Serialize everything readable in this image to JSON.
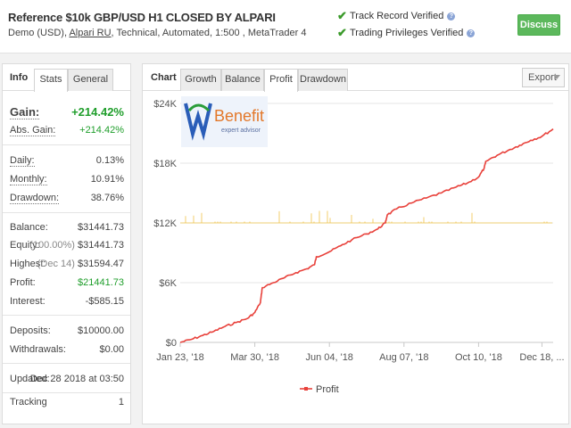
{
  "header": {
    "title": "Reference $10k GBP/USD H1 CLOSED BY ALPARI",
    "sub_prefix": "Demo (USD),",
    "broker": "Alpari RU",
    "sub_suffix": ", Technical, Automated, 1:500 , MetaTrader 4",
    "verify_track": "Track Record Verified",
    "verify_trading": "Trading Privileges Verified",
    "discuss_label": "Discuss",
    "accent_green": "#5cb85c"
  },
  "info": {
    "label": "Info",
    "tabs": [
      "Stats",
      "General"
    ],
    "active_tab": "Stats",
    "gain_label": "Gain:",
    "gain_value": "+214.42%",
    "abs_gain_label": "Abs. Gain:",
    "abs_gain_value": "+214.42%",
    "daily_label": "Daily:",
    "daily_value": "0.13%",
    "monthly_label": "Monthly:",
    "monthly_value": "10.91%",
    "drawdown_label": "Drawdown:",
    "drawdown_value": "38.76%",
    "balance_label": "Balance:",
    "balance_value": "$31441.73",
    "equity_label": "Equity:",
    "equity_note": "(100.00%)",
    "equity_value": "$31441.73",
    "highest_label": "Highest:",
    "highest_note": "(Dec 14)",
    "highest_value": "$31594.47",
    "profit_label": "Profit:",
    "profit_value": "$21441.73",
    "interest_label": "Interest:",
    "interest_value": "-$585.15",
    "deposits_label": "Deposits:",
    "deposits_value": "$10000.00",
    "withdrawals_label": "Withdrawals:",
    "withdrawals_value": "$0.00",
    "updated_label": "Updated:",
    "updated_value": "Dec 28 2018 at 03:50",
    "tracking_label": "Tracking",
    "tracking_value": "1"
  },
  "chart": {
    "label": "Chart",
    "tabs": [
      "Growth",
      "Balance",
      "Profit",
      "Drawdown"
    ],
    "active_tab": "Profit",
    "export_label": "Export",
    "logo_text": "Benefit",
    "logo_sub": "expert advisor"
  },
  "chart_data": {
    "type": "line",
    "title": "",
    "xlabel": "",
    "ylabel": "",
    "ylim": [
      0,
      24000
    ],
    "y_ticks": [
      {
        "value": 0,
        "label": "$0"
      },
      {
        "value": 6000,
        "label": "$6K"
      },
      {
        "value": 12000,
        "label": "$12K"
      },
      {
        "value": 18000,
        "label": "$18K"
      },
      {
        "value": 24000,
        "label": "$24K"
      }
    ],
    "x_ticks": [
      {
        "pos": 0.0,
        "label": "Jan 23, '18"
      },
      {
        "pos": 0.2,
        "label": "Mar 30, '18"
      },
      {
        "pos": 0.4,
        "label": "Jun 04, '18"
      },
      {
        "pos": 0.6,
        "label": "Aug 07, '18"
      },
      {
        "pos": 0.8,
        "label": "Oct 10, '18"
      },
      {
        "pos": 0.97,
        "label": "Dec 18, ..."
      }
    ],
    "grid": true,
    "legend": "bottom-center",
    "series": [
      {
        "name": "Profit",
        "color": "#e8413b",
        "x": [
          0.0,
          0.03,
          0.06,
          0.09,
          0.12,
          0.15,
          0.18,
          0.2,
          0.215,
          0.22,
          0.25,
          0.28,
          0.31,
          0.34,
          0.36,
          0.365,
          0.4,
          0.43,
          0.46,
          0.5,
          0.53,
          0.55,
          0.555,
          0.58,
          0.62,
          0.66,
          0.7,
          0.74,
          0.77,
          0.8,
          0.815,
          0.82,
          0.85,
          0.88,
          0.91,
          0.94,
          0.97,
          1.0
        ],
        "y": [
          0,
          300,
          700,
          1100,
          1600,
          2000,
          2400,
          3000,
          4000,
          5500,
          6000,
          6500,
          7000,
          7400,
          7800,
          8600,
          9100,
          9700,
          10300,
          10900,
          11400,
          12000,
          12800,
          13400,
          14000,
          14500,
          15000,
          15600,
          16000,
          16600,
          17500,
          18200,
          18800,
          19300,
          19800,
          20300,
          20700,
          21441
        ]
      },
      {
        "name": "",
        "color": "#f0c34a",
        "baseline": 12000
      }
    ]
  }
}
